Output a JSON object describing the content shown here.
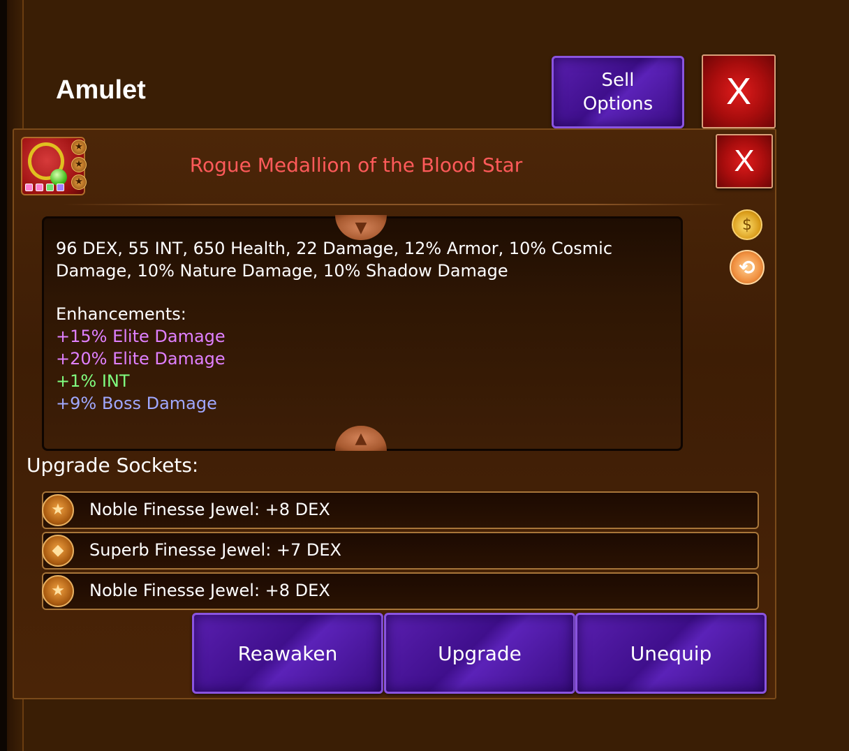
{
  "header": {
    "title": "Amulet",
    "sell_label": "Sell Options",
    "close_label": "X"
  },
  "item": {
    "name": "Rogue Medallion of the Blood Star",
    "name_color": "#ff5a5a",
    "close_label": "X",
    "stats": "96 DEX, 55 INT, 650 Health, 22 Damage, 12% Armor, 10% Cosmic Damage, 10% Nature Damage, 10% Shadow Damage",
    "enhancements_title": "Enhancements:",
    "enhancements": [
      {
        "text": "+15% Elite Damage",
        "color": "#e080ff"
      },
      {
        "text": "+20% Elite Damage",
        "color": "#e080ff"
      },
      {
        "text": "+1% INT",
        "color": "#80ff80"
      },
      {
        "text": "+9% Boss Damage",
        "color": "#a0a8ff"
      }
    ],
    "socket_dot_colors": [
      "#ff80d0",
      "#ff80d0",
      "#70e070",
      "#a080ff"
    ]
  },
  "sockets": {
    "title": "Upgrade Sockets:",
    "items": [
      {
        "label": "Noble Finesse Jewel: +8 DEX"
      },
      {
        "label": "Superb Finesse Jewel: +7 DEX"
      },
      {
        "label": "Noble Finesse Jewel: +8 DEX"
      }
    ]
  },
  "actions": {
    "reawaken": "Reawaken",
    "upgrade": "Upgrade",
    "unequip": "Unequip"
  },
  "icons": {
    "gold_bag": "gold-bag-icon",
    "swap": "swap-icon"
  }
}
